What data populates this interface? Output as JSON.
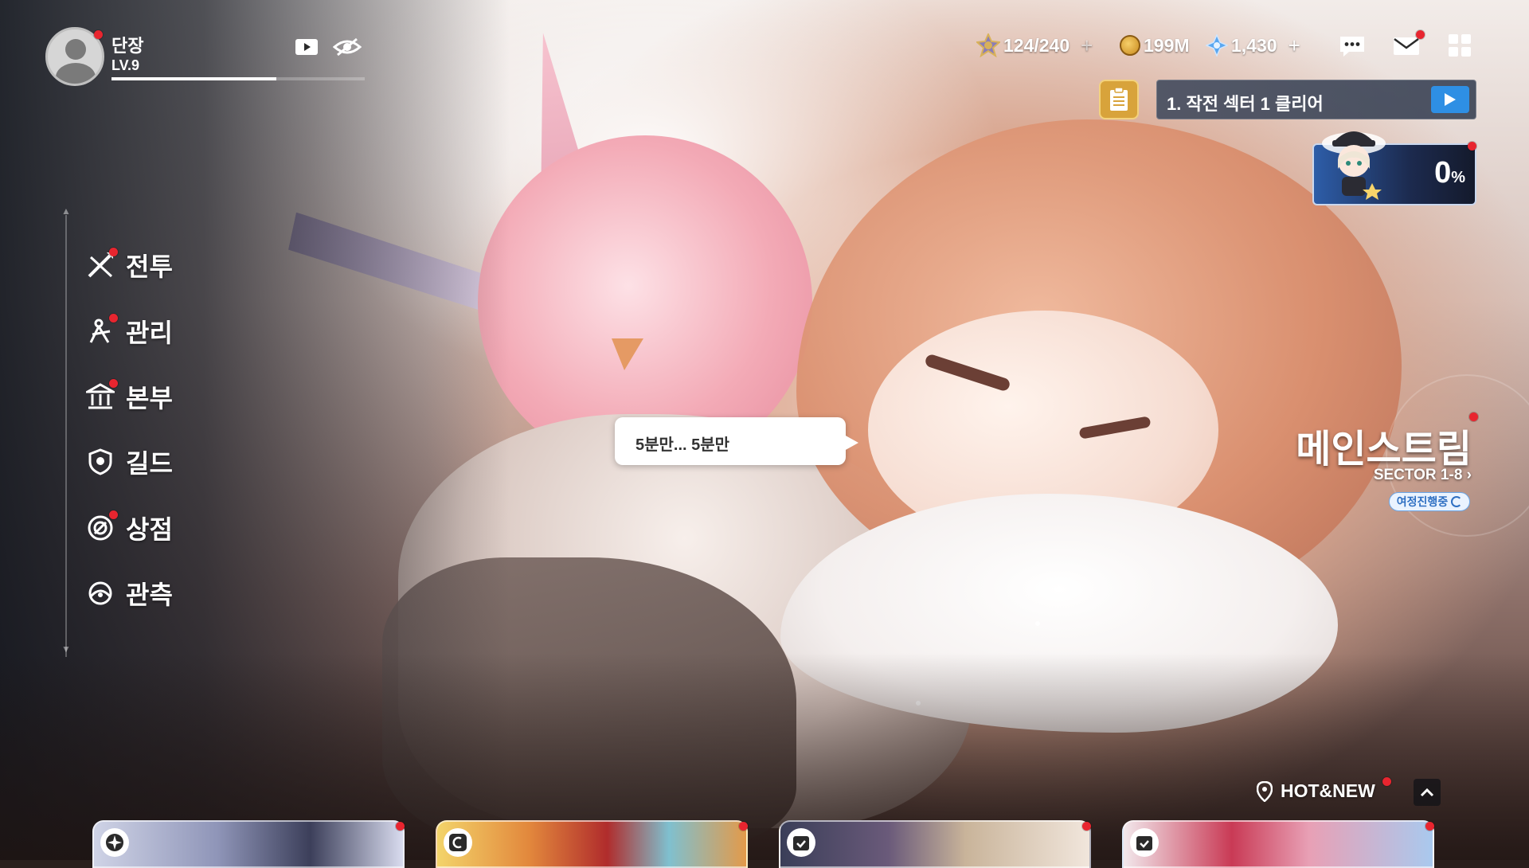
{
  "profile": {
    "name": "단장",
    "level": "LV.9",
    "xp_fraction": 0.65
  },
  "resources": {
    "stamina": "124/240",
    "gold": "199M",
    "gems": "1,430",
    "plus_symbol": "+"
  },
  "quest": {
    "text": "1. 작전 섹터 1 클리어"
  },
  "character_panel": {
    "percent": "0",
    "unit": "%"
  },
  "menu": {
    "items": [
      {
        "label": "전투",
        "icon": "battle-icon"
      },
      {
        "label": "관리",
        "icon": "manage-icon"
      },
      {
        "label": "본부",
        "icon": "headquarters-icon"
      },
      {
        "label": "길드",
        "icon": "guild-icon"
      },
      {
        "label": "상점",
        "icon": "shop-icon"
      },
      {
        "label": "관측",
        "icon": "observe-icon"
      }
    ]
  },
  "speech_bubble": {
    "text": "5분만... 5분만"
  },
  "main_stream": {
    "title": "메인스트림",
    "sector": "SECTOR 1-8 ›",
    "badge": "여정진행중"
  },
  "hot_new": {
    "label": "HOT&NEW"
  },
  "colors": {
    "notification": "#e8252f",
    "accent_blue": "#2e8fe4",
    "quest_doc": "#d8a33b"
  }
}
